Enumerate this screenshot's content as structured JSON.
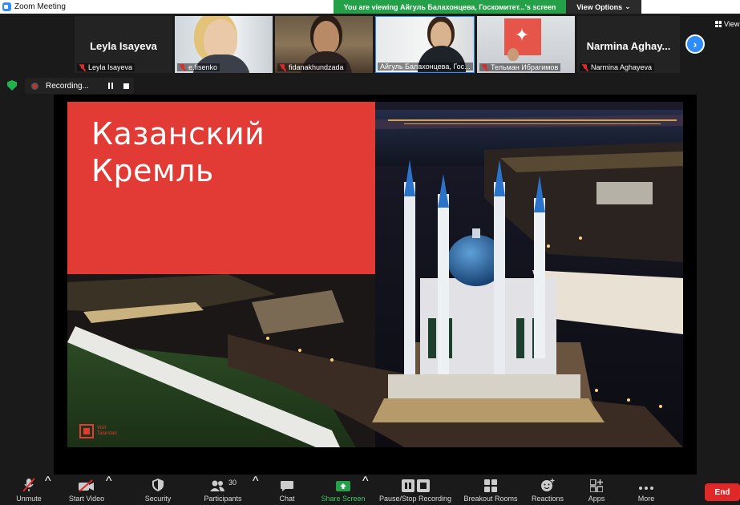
{
  "window": {
    "title": "Zoom Meeting"
  },
  "share_banner": {
    "text": "You are viewing Айгуль Балахонцева, Госкомитет...'s screen"
  },
  "view_options": {
    "label": "View Options"
  },
  "strip": {
    "view_label": "View",
    "participants": [
      {
        "name_center": "Leyla Isayeva",
        "label": "Leyla Isayeva"
      },
      {
        "label": "e.fisenko"
      },
      {
        "label": "fidanakhundzada"
      },
      {
        "label": "Айгуль Балахонцева, Гос..."
      },
      {
        "label": "Тельман Ибрагимов"
      },
      {
        "name_center": "Narmina  Aghay...",
        "label": "Narmina Aghayeva"
      }
    ]
  },
  "recording": {
    "text": "Recording..."
  },
  "slide": {
    "title_line1": "Казанский",
    "title_line2": "Кремль",
    "logo_line1": "Visit",
    "logo_line2": "Tatarstan"
  },
  "toolbar": {
    "unmute": "Unmute",
    "start_video": "Start Video",
    "security": "Security",
    "participants": "Participants",
    "participants_count": "30",
    "chat": "Chat",
    "share_screen": "Share Screen",
    "pause_stop_recording": "Pause/Stop Recording",
    "breakout_rooms": "Breakout Rooms",
    "reactions": "Reactions",
    "apps": "Apps",
    "more": "More",
    "end": "End"
  },
  "colors": {
    "zoom_blue": "#2d8cff",
    "share_green": "#24a148",
    "slide_red": "#e23a35",
    "end_red": "#e02828",
    "background": "#1a1a1a"
  }
}
